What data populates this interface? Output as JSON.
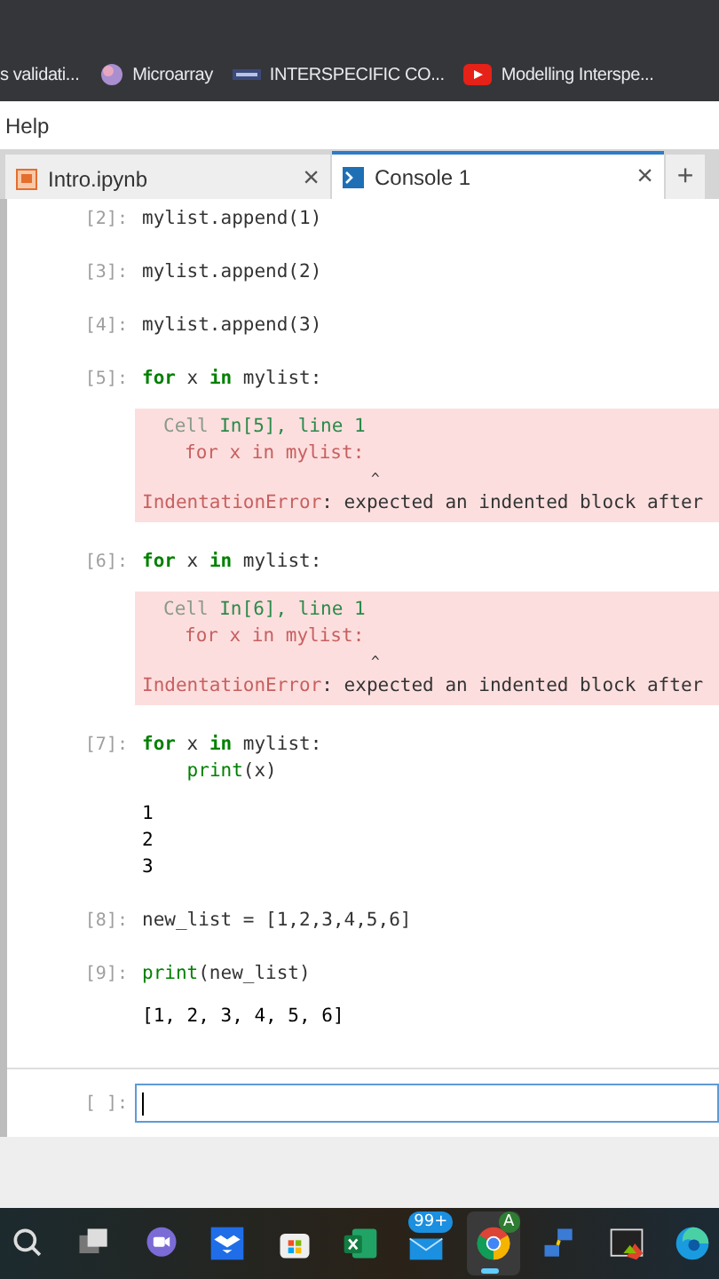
{
  "bookmarks": [
    {
      "label": "s validati...",
      "kind": "none"
    },
    {
      "label": "Microarray",
      "kind": "orb"
    },
    {
      "label": "INTERSPECIFIC CO...",
      "kind": "tier"
    },
    {
      "label": "Modelling Interspe...",
      "kind": "video"
    }
  ],
  "menu": [
    "Help"
  ],
  "tabs": [
    {
      "label": "Intro.ipynb",
      "kind": "notebook",
      "selected": false,
      "close": "×"
    },
    {
      "label": "Console 1",
      "kind": "console",
      "selected": true,
      "close": "×"
    }
  ],
  "new_tab": "+",
  "cells": [
    {
      "prompt": "[2]:",
      "code": [
        "mylist.append(1)"
      ]
    },
    {
      "prompt": "[3]:",
      "code": [
        "mylist.append(2)"
      ]
    },
    {
      "prompt": "[4]:",
      "code": [
        "mylist.append(3)"
      ]
    },
    {
      "prompt": "[5]:",
      "code": [
        "**for** x **in** mylist:"
      ],
      "output": {
        "kind": "error",
        "location": "Cell",
        "where": "In[5], line 1",
        "source": "for x in mylist:",
        "caret": "^",
        "name": "IndentationError",
        "message": ": expected an indented block after"
      }
    },
    {
      "prompt": "[6]:",
      "code": [
        "**for** x **in** mylist:"
      ],
      "output": {
        "kind": "error",
        "location": "Cell",
        "where": "In[6], line 1",
        "source": "for x in mylist:",
        "caret": "^",
        "name": "IndentationError",
        "message": ": expected an indented block after"
      }
    },
    {
      "prompt": "[7]:",
      "code": [
        "**for** x **in** mylist:",
        "    *print*(x)"
      ],
      "output": {
        "kind": "stream",
        "lines": [
          "1",
          "2",
          "3"
        ]
      }
    },
    {
      "prompt": "[8]:",
      "code": [
        "new_list = [1,2,3,4,5,6]"
      ]
    },
    {
      "prompt": "[9]:",
      "code": [
        "*print*(new_list)"
      ],
      "output": {
        "kind": "stream",
        "lines": [
          "[1, 2, 3, 4, 5, 6]"
        ]
      }
    }
  ],
  "input_prompt": "[ ]:",
  "taskbar": [
    {
      "kind": "search",
      "selected": false
    },
    {
      "kind": "taskview",
      "selected": false
    },
    {
      "kind": "chat",
      "selected": false
    },
    {
      "kind": "dropbox",
      "selected": false
    },
    {
      "kind": "store",
      "selected": false
    },
    {
      "kind": "excel",
      "selected": false
    },
    {
      "kind": "mail",
      "selected": false,
      "badge": "99+"
    },
    {
      "kind": "chrome",
      "selected": true,
      "badge": "A"
    },
    {
      "kind": "network",
      "selected": false
    },
    {
      "kind": "terminal",
      "selected": false
    },
    {
      "kind": "edge",
      "selected": false
    }
  ]
}
